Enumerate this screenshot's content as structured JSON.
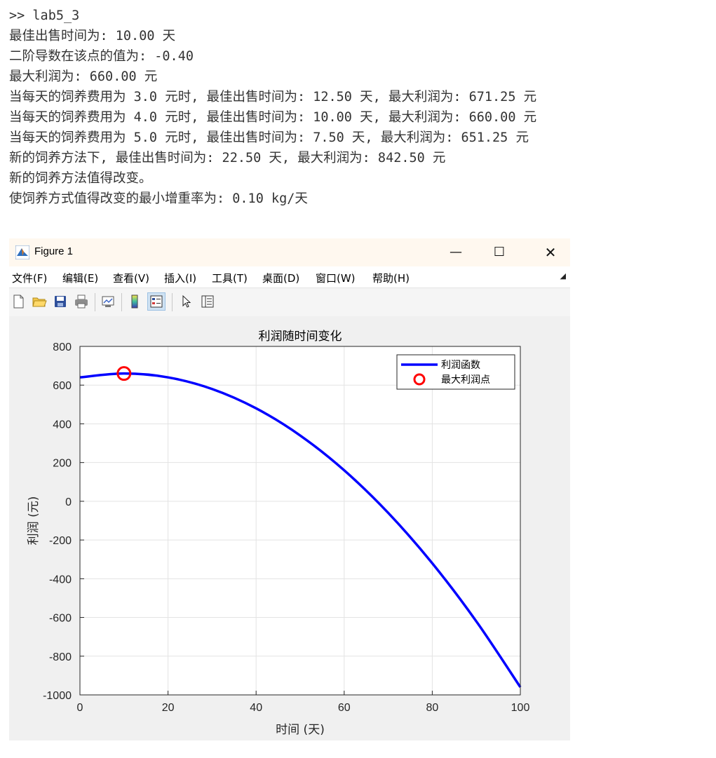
{
  "console": {
    "lines": [
      ">> lab5_3",
      "最佳出售时间为: 10.00 天",
      "二阶导数在该点的值为: -0.40",
      "最大利润为: 660.00 元",
      "当每天的饲养费用为 3.0 元时, 最佳出售时间为: 12.50 天, 最大利润为: 671.25 元",
      "当每天的饲养费用为 4.0 元时, 最佳出售时间为: 10.00 天, 最大利润为: 660.00 元",
      "当每天的饲养费用为 5.0 元时, 最佳出售时间为: 7.50 天, 最大利润为: 651.25 元",
      "新的饲养方法下, 最佳出售时间为: 22.50 天, 最大利润为: 842.50 元",
      "新的饲养方法值得改变。",
      "使饲养方式值得改变的最小增重率为: 0.10 kg/天"
    ]
  },
  "window": {
    "title": "Figure 1",
    "icon": "matlab-figure-icon",
    "controls": {
      "minimize": "—",
      "maximize": "☐",
      "close": "✕"
    }
  },
  "menubar": {
    "items": [
      "文件(F)",
      "编辑(E)",
      "查看(V)",
      "插入(I)",
      "工具(T)",
      "桌面(D)",
      "窗口(W)",
      "帮助(H)"
    ],
    "expand_icon": "dock-arrow-icon"
  },
  "toolbar": {
    "tools": [
      "new-figure-icon",
      "open-file-icon",
      "save-icon",
      "print-icon",
      "link-plot-icon",
      "insert-colorbar-icon",
      "insert-legend-icon",
      "edit-plot-pointer-icon",
      "property-inspector-icon"
    ]
  },
  "chart_data": {
    "type": "line",
    "title": "利润随时间变化",
    "xlabel": "时间 (天)",
    "ylabel": "利润 (元)",
    "xlim": [
      0,
      100
    ],
    "ylim": [
      -1000,
      800
    ],
    "xticks": [
      0,
      20,
      40,
      60,
      80,
      100
    ],
    "yticks": [
      800,
      600,
      400,
      200,
      0,
      -200,
      -400,
      -600,
      -800,
      -1000
    ],
    "grid": true,
    "legend_position": "top-right",
    "series": [
      {
        "name": "利润函数",
        "color": "#0000ff",
        "x": [
          0,
          10,
          20,
          30,
          40,
          50,
          60,
          70,
          80,
          90,
          100
        ],
        "y": [
          640,
          660,
          640,
          580,
          480,
          340,
          160,
          -60,
          -320,
          -620,
          -960
        ]
      },
      {
        "name": "最大利润点",
        "color": "#ff0000",
        "marker": "circle",
        "x": [
          10
        ],
        "y": [
          660
        ]
      }
    ]
  }
}
